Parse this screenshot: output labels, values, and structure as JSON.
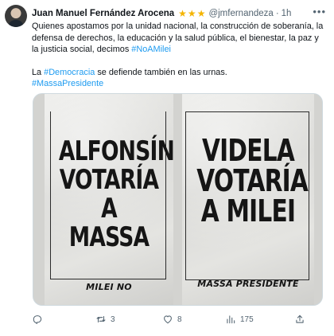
{
  "author": {
    "name": "Juan Manuel Fernández Arocena",
    "handle": "@jmfernandeza",
    "separator": "·",
    "time": "1h"
  },
  "tweet": {
    "line1": "Quienes apostamos por la unidad nacional, la construcción de soberanía, la defensa de derechos, la educación y la salud pública, el bienestar, la paz y la justicia social, decimos ",
    "tag_noamilei": "#NoAMilei",
    "line2_prefix": "La ",
    "tag_democracia": "#Democracia",
    "line2_suffix": " se defiende también en las urnas.",
    "tag_massa": "#MassaPresidente"
  },
  "media": {
    "left_poster": {
      "lines": [
        "ALFONSÍN",
        "VOTARÍA",
        "A MASSA"
      ],
      "footer": "MILEI NO"
    },
    "right_poster": {
      "lines": [
        "VIDELA",
        "VOTARÍA",
        "A MILEI"
      ],
      "footer": "MASSA PRESIDENTE"
    }
  },
  "actions": {
    "reply_count": "",
    "retweet_count": "3",
    "like_count": "8",
    "views_count": "175"
  },
  "icons": {
    "star": "star-icon",
    "more": "more-options-icon",
    "reply": "reply-icon",
    "retweet": "retweet-icon",
    "like": "heart-icon",
    "views": "views-chart-icon",
    "share": "share-icon"
  },
  "colors": {
    "link": "#1d9bf0",
    "secondary_text": "#536471",
    "star": "#f4b400"
  }
}
